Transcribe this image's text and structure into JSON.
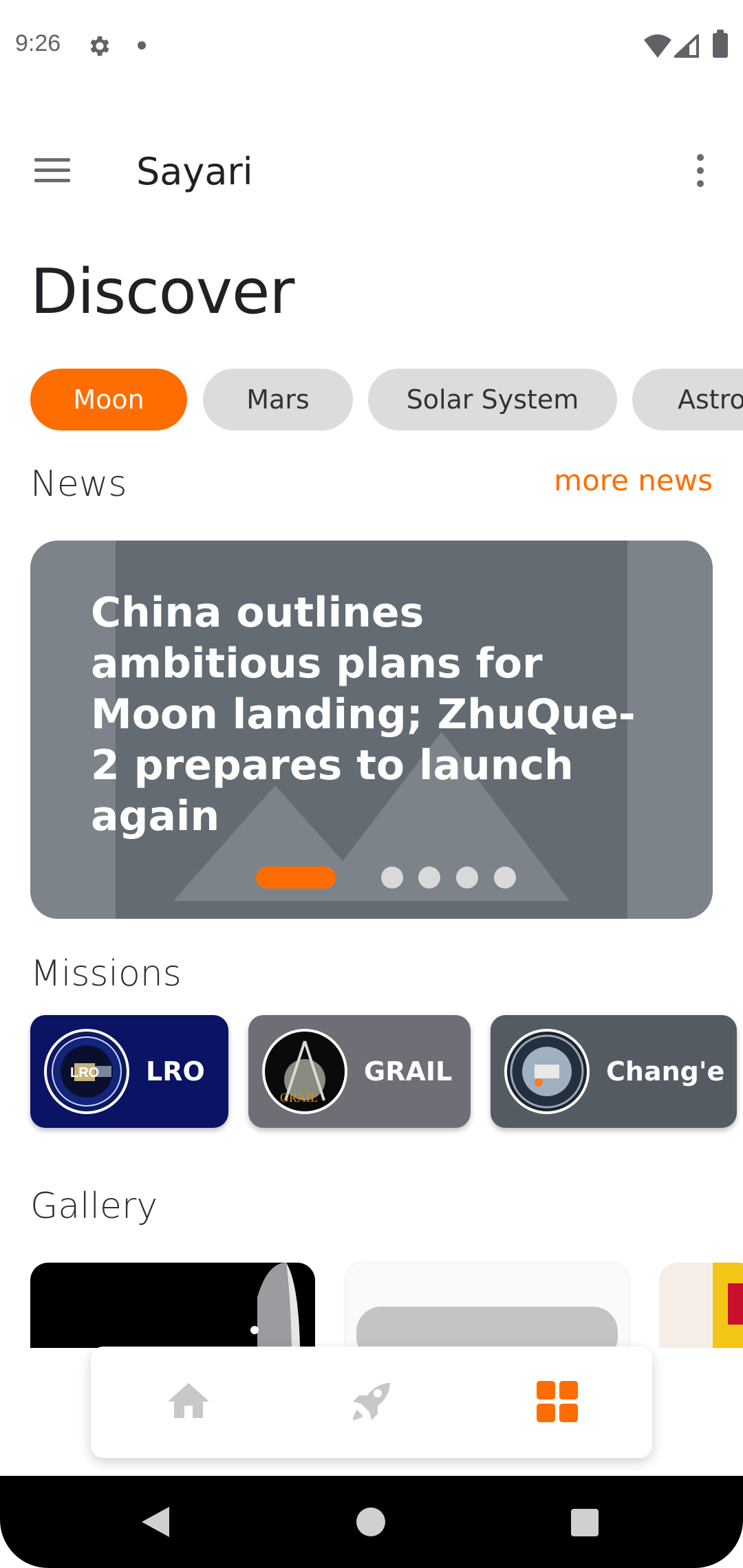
{
  "status_bar": {
    "time": "9:26",
    "icons": [
      "gear-icon",
      "notification-dot",
      "wifi-icon",
      "signal-icon",
      "battery-icon"
    ]
  },
  "app_bar": {
    "title": "Sayari",
    "menu_icon": "menu-icon",
    "overflow_icon": "more-vertical-icon"
  },
  "page": {
    "title": "Discover"
  },
  "categories": [
    {
      "label": "Moon",
      "selected": true
    },
    {
      "label": "Mars",
      "selected": false
    },
    {
      "label": "Solar System",
      "selected": false
    },
    {
      "label": "Astro",
      "selected": false
    }
  ],
  "news": {
    "section_label": "News",
    "more_label": "more news",
    "headline": "China outlines ambitious plans for Moon landing; ZhuQue-2 prepares to launch again",
    "carousel_total": 5,
    "carousel_active": 1
  },
  "missions": {
    "section_label": "Missions",
    "items": [
      {
        "name": "LRO",
        "color": "#0a1364"
      },
      {
        "name": "GRAIL",
        "color": "#6e6e76"
      },
      {
        "name": "Chang'e",
        "color": "#545b63"
      }
    ]
  },
  "gallery": {
    "section_label": "Gallery"
  },
  "bottom_nav": {
    "items": [
      {
        "icon": "home-icon",
        "active": false
      },
      {
        "icon": "rocket-icon",
        "active": false
      },
      {
        "icon": "grid-icon",
        "active": true
      }
    ]
  },
  "colors": {
    "accent": "#ff6d00",
    "chip_bg": "#dcdcdc",
    "inactive_icon": "#c8c8c8"
  }
}
